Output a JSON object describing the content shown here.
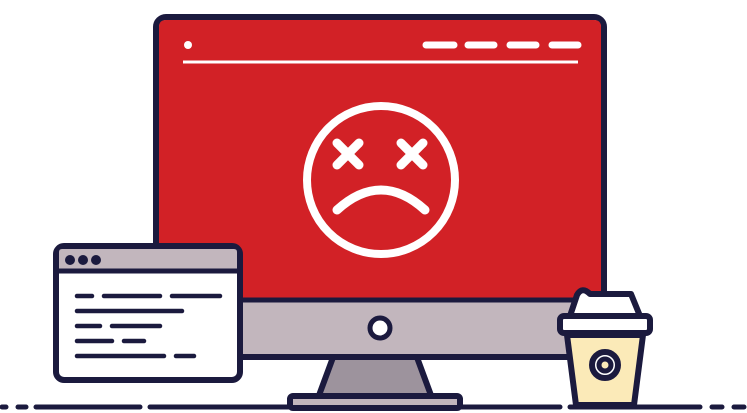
{
  "illustration": {
    "monitor": {
      "screen_state": "error",
      "face_icon": "sad-face-x-eyes-icon",
      "titlebar_icon": "window-dot-icon"
    },
    "code_window": {
      "titlebar_icon": "three-dots-icon"
    },
    "coffee_cup": {
      "icon": "takeaway-coffee-cup-icon"
    },
    "colors": {
      "screen_red": "#D22126",
      "outline_navy": "#1B1A3E",
      "bezel_gray": "#C2B6BD",
      "stand_gray": "#9D939D",
      "cup_cream": "#FBEAB8",
      "white": "#FFFFFF"
    }
  }
}
